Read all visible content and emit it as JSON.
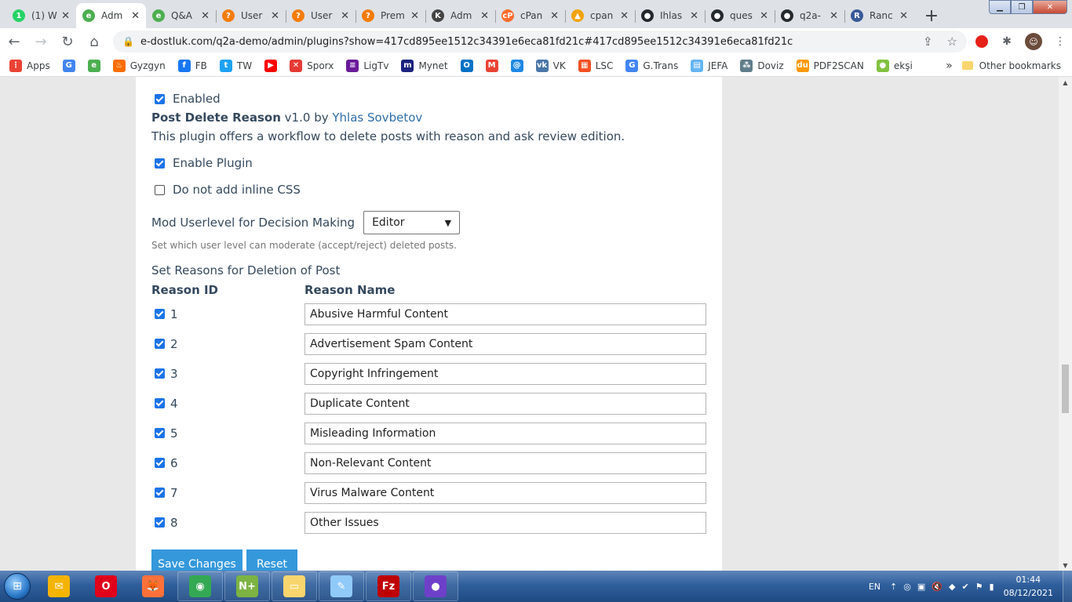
{
  "browser": {
    "tabs": [
      {
        "title": "(1) W",
        "icon": "whatsapp-icon",
        "color": "#25d366",
        "glyph": "1"
      },
      {
        "title": "Adm",
        "icon": "q2a-icon",
        "color": "#4caf50",
        "glyph": "e",
        "active": true
      },
      {
        "title": "Q&A",
        "icon": "q2a-icon",
        "color": "#4caf50",
        "glyph": "e"
      },
      {
        "title": "User",
        "icon": "question-icon",
        "color": "#f57c00",
        "glyph": "?"
      },
      {
        "title": "User",
        "icon": "question-icon",
        "color": "#f57c00",
        "glyph": "?"
      },
      {
        "title": "Prem",
        "icon": "question-icon",
        "color": "#f57c00",
        "glyph": "?"
      },
      {
        "title": "Adm",
        "icon": "k-icon",
        "color": "#444444",
        "glyph": "K"
      },
      {
        "title": "cPan",
        "icon": "cpanel-icon",
        "color": "#ff6c2c",
        "glyph": "cP"
      },
      {
        "title": "cpan",
        "icon": "phpmyadmin-icon",
        "color": "#f0a30a",
        "glyph": "▲"
      },
      {
        "title": "Ihlas",
        "icon": "github-icon",
        "color": "#24292e",
        "glyph": "●"
      },
      {
        "title": "ques",
        "icon": "github-icon",
        "color": "#24292e",
        "glyph": "●"
      },
      {
        "title": "q2a-",
        "icon": "github-icon",
        "color": "#24292e",
        "glyph": "●"
      },
      {
        "title": "Ranc",
        "icon": "r-icon",
        "color": "#3a5a98",
        "glyph": "R"
      }
    ],
    "url": "e-dostluk.com/q2a-demo/admin/plugins?show=417cd895ee1512c34391e6eca81fd21c#417cd895ee1512c34391e6eca81fd21c"
  },
  "bookmarks": [
    {
      "label": "Apps",
      "icon": "apps-grid-icon",
      "color": "#ea4335",
      "glyph": "⋮"
    },
    {
      "label": "",
      "icon": "google-icon",
      "color": "#4285f4",
      "glyph": "G"
    },
    {
      "label": "",
      "icon": "q2a-icon",
      "color": "#4caf50",
      "glyph": "e"
    },
    {
      "label": "Gyzgyn",
      "icon": "fire-icon",
      "color": "#ff6d00",
      "glyph": "♨"
    },
    {
      "label": "FB",
      "icon": "facebook-icon",
      "color": "#1877f2",
      "glyph": "f"
    },
    {
      "label": "TW",
      "icon": "twitter-icon",
      "color": "#1da1f2",
      "glyph": "t"
    },
    {
      "label": "",
      "icon": "youtube-icon",
      "color": "#ff0000",
      "glyph": "▶"
    },
    {
      "label": "Sporx",
      "icon": "sporx-icon",
      "color": "#e53935",
      "glyph": "✕"
    },
    {
      "label": "LigTv",
      "icon": "ligtv-icon",
      "color": "#6a1b9a",
      "glyph": "≡"
    },
    {
      "label": "Mynet",
      "icon": "mynet-icon",
      "color": "#1a237e",
      "glyph": "m"
    },
    {
      "label": "",
      "icon": "outlook-icon",
      "color": "#0072c6",
      "glyph": "O"
    },
    {
      "label": "",
      "icon": "gmail-icon",
      "color": "#ea4335",
      "glyph": "M"
    },
    {
      "label": "",
      "icon": "at-icon",
      "color": "#1e88e5",
      "glyph": "@"
    },
    {
      "label": "VK",
      "icon": "vk-icon",
      "color": "#4a76a8",
      "glyph": "vk"
    },
    {
      "label": "LSC",
      "icon": "microsoft-icon",
      "color": "#f25022",
      "glyph": "▦"
    },
    {
      "label": "G.Trans",
      "icon": "translate-icon",
      "color": "#4285f4",
      "glyph": "G"
    },
    {
      "label": "JEFA",
      "icon": "chart-icon",
      "color": "#64b5f6",
      "glyph": "▤"
    },
    {
      "label": "Doviz",
      "icon": "doviz-icon",
      "color": "#607d8b",
      "glyph": "⁂"
    },
    {
      "label": "PDF2SCAN",
      "icon": "pdf-icon",
      "color": "#ff9800",
      "glyph": "du"
    },
    {
      "label": "ekşi",
      "icon": "eksi-icon",
      "color": "#81c141",
      "glyph": "●"
    }
  ],
  "bookmarks_more": "»",
  "other_bookmarks": "Other bookmarks",
  "plugin": {
    "enabled_label": "Enabled",
    "name": "Post Delete Reason",
    "version": "v1.0",
    "by": "by",
    "author": "Yhlas Sovbetov",
    "description": "This plugin offers a workflow to delete posts with reason and ask review edition.",
    "enable_plugin_label": "Enable Plugin",
    "no_inline_css_label": "Do not add inline CSS",
    "mod_level_label": "Mod Userlevel for Decision Making",
    "mod_level_value": "Editor",
    "mod_level_hint": "Set which user level can moderate (accept/reject) deleted posts.",
    "reasons_heading": "Set Reasons for Deletion of Post",
    "col_id": "Reason ID",
    "col_name": "Reason Name",
    "reasons": [
      {
        "id": "1",
        "name": "Abusive Harmful Content",
        "checked": true
      },
      {
        "id": "2",
        "name": "Advertisement Spam Content",
        "checked": true
      },
      {
        "id": "3",
        "name": "Copyright Infringement",
        "checked": true
      },
      {
        "id": "4",
        "name": "Duplicate Content",
        "checked": true
      },
      {
        "id": "5",
        "name": "Misleading Information",
        "checked": true
      },
      {
        "id": "6",
        "name": "Non-Relevant Content",
        "checked": true
      },
      {
        "id": "7",
        "name": "Virus Malware Content",
        "checked": true
      },
      {
        "id": "8",
        "name": "Other Issues",
        "checked": true
      }
    ],
    "save_label": "Save Changes",
    "reset_label": "Reset"
  },
  "taskbar": {
    "apps": [
      {
        "icon": "outlook-mail-icon",
        "color": "#f4b400",
        "glyph": "✉"
      },
      {
        "icon": "opera-icon",
        "color": "#e1001a",
        "glyph": "O"
      },
      {
        "icon": "firefox-icon",
        "color": "#ff7139",
        "glyph": "🦊"
      },
      {
        "icon": "chrome-icon",
        "color": "#34a853",
        "glyph": "◉"
      },
      {
        "icon": "notepad-plus-icon",
        "color": "#7cb342",
        "glyph": "N+"
      },
      {
        "icon": "file-explorer-icon",
        "color": "#f9d56e",
        "glyph": "▭"
      },
      {
        "icon": "notepad-icon",
        "color": "#90caf9",
        "glyph": "✎"
      },
      {
        "icon": "filezilla-icon",
        "color": "#bf0000",
        "glyph": "Fz"
      },
      {
        "icon": "github-desktop-icon",
        "color": "#6e40c9",
        "glyph": "●"
      }
    ],
    "language": "EN",
    "time": "01:44",
    "date": "08/12/2021"
  }
}
